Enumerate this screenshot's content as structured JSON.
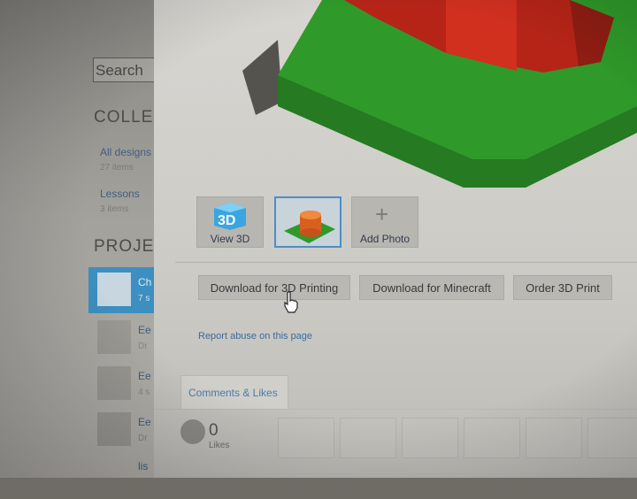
{
  "sidebar": {
    "search_placeholder": "Search",
    "collections_heading": "COLLE",
    "collections": [
      {
        "label": "All designs",
        "count": "27 items"
      },
      {
        "label": "Lessons",
        "count": "3 items"
      }
    ],
    "projects_heading": "PROJE",
    "projects": [
      {
        "name": "Ch",
        "meta": "7 s",
        "active": true
      },
      {
        "name": "Ee",
        "meta": "Dr",
        "active": false
      },
      {
        "name": "Ee",
        "meta": "4 s",
        "active": false
      },
      {
        "name": "Ee",
        "meta": "Dr",
        "active": false
      },
      {
        "name": "lis",
        "meta": "",
        "active": false
      }
    ]
  },
  "modal": {
    "thumbnails": [
      {
        "label": "View 3D",
        "icon": "3d-cube-icon",
        "selected": false
      },
      {
        "label": "",
        "icon": "model-thumbnail",
        "selected": true
      },
      {
        "label": "Add Photo",
        "icon": "plus-icon",
        "selected": false
      }
    ],
    "thumb_3d_badge": "3D",
    "actions": {
      "download_3d": "Download for 3D Printing",
      "download_minecraft": "Download for Minecraft",
      "order_print": "Order 3D Print"
    },
    "report_link": "Report abuse on this page",
    "comments_tab": "Comments & Likes",
    "likes": {
      "count": "0",
      "label": "Likes"
    }
  },
  "colors": {
    "accent": "#3c8fc0",
    "model_green": "#2f9a2a",
    "model_red": "#c02a1c",
    "link": "#3d6b99"
  }
}
